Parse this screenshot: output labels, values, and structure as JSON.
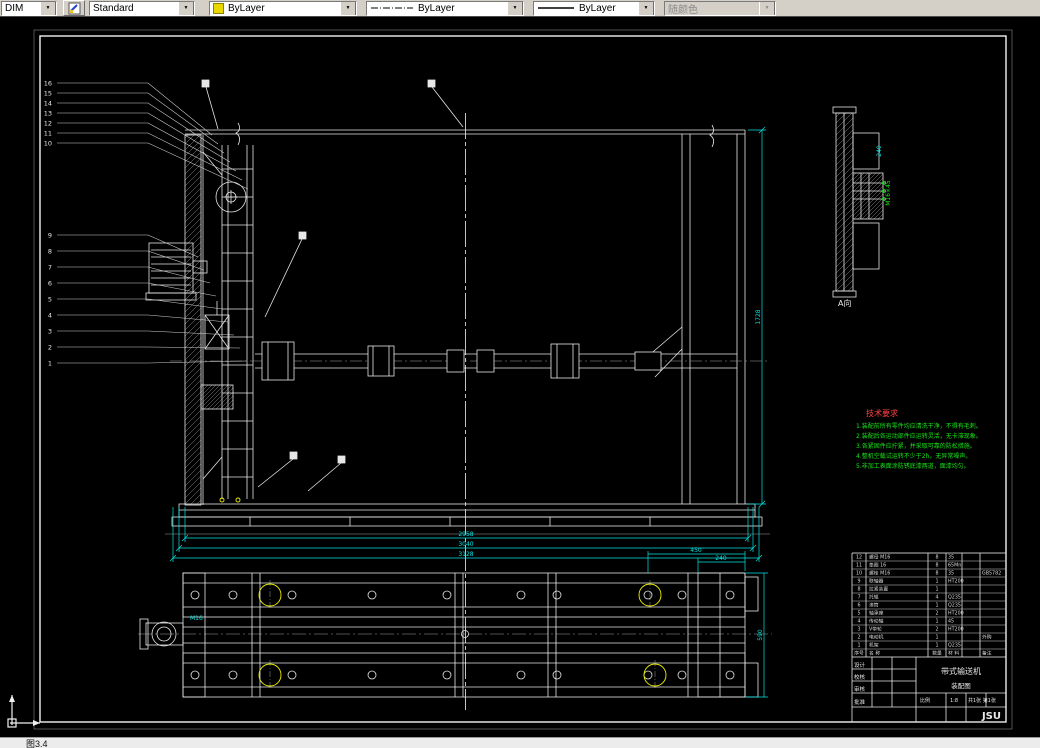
{
  "toolbar": {
    "layer_value": "DIM",
    "style_value": "Standard",
    "color_value": "ByLayer",
    "linetype_value": "ByLayer",
    "lineweight_value": "ByLayer",
    "plotstyle_value": "随颜色"
  },
  "canvas": {
    "figure_caption": "图3.4",
    "balloons_top": [
      "16",
      "15",
      "14",
      "13",
      "12",
      "11",
      "10"
    ],
    "balloons_bottom": [
      "9",
      "8",
      "7",
      "6",
      "5",
      "4",
      "3",
      "2",
      "1"
    ],
    "dimensions": {
      "overall_inner": "2958",
      "overall_mid": "3040",
      "overall_outer": "3128",
      "height": "1728",
      "plan_height": "590",
      "plan_top_long": "450",
      "plan_top_short": "240",
      "plan_thread": "M16",
      "section_bolt": "M16×45",
      "section_width": "240"
    },
    "section_label": "A向",
    "notes": {
      "heading": "技术要求",
      "lines": [
        "1.装配前所有零件均应清洗干净，不得有毛刺。",
        "2.装配后各运动部件应运转灵活，无卡滞现象。",
        "3.各紧固件应拧紧，并采取可靠的防松措施。",
        "4.整机空载试运转不少于2h，无异常噪声。",
        "5.非加工表面涂防锈底漆两道，面漆均匀。"
      ]
    },
    "bom": {
      "rows": [
        {
          "no": "序号",
          "name": "名 称",
          "qty": "数量",
          "mat": "材 料",
          "note": "备注"
        },
        {
          "no": "1",
          "name": "机架",
          "qty": "1",
          "mat": "Q235",
          "note": ""
        },
        {
          "no": "2",
          "name": "电动机",
          "qty": "1",
          "mat": "",
          "note": "外购"
        },
        {
          "no": "3",
          "name": "V带轮",
          "qty": "2",
          "mat": "HT200",
          "note": ""
        },
        {
          "no": "4",
          "name": "传动轴",
          "qty": "1",
          "mat": "45",
          "note": ""
        },
        {
          "no": "5",
          "name": "轴承座",
          "qty": "2",
          "mat": "HT200",
          "note": ""
        },
        {
          "no": "6",
          "name": "滚筒",
          "qty": "1",
          "mat": "Q235",
          "note": ""
        },
        {
          "no": "7",
          "name": "托辊",
          "qty": "4",
          "mat": "Q235",
          "note": ""
        },
        {
          "no": "8",
          "name": "拉紧装置",
          "qty": "1",
          "mat": "",
          "note": ""
        },
        {
          "no": "9",
          "name": "联轴器",
          "qty": "1",
          "mat": "HT200",
          "note": ""
        },
        {
          "no": "10",
          "name": "螺栓 M16",
          "qty": "8",
          "mat": "35",
          "note": "GB5782"
        },
        {
          "no": "11",
          "name": "垫圈 16",
          "qty": "8",
          "mat": "65Mn",
          "note": ""
        },
        {
          "no": "12",
          "name": "螺母 M16",
          "qty": "8",
          "mat": "35",
          "note": ""
        }
      ]
    },
    "title_block": {
      "role1": "设计",
      "role2": "校核",
      "role3": "审核",
      "role4": "批准",
      "title": "带式输送机",
      "subtitle": "装配图",
      "scale_label": "比例",
      "scale_value": "1:8",
      "sheet": "共1张 第1张",
      "logo": "JSU"
    }
  }
}
